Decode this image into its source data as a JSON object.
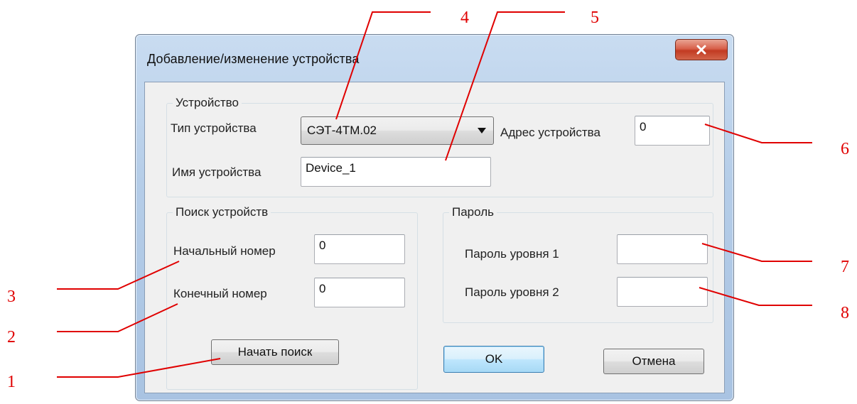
{
  "window": {
    "title": "Добавление/изменение устройства",
    "close_label": "✕"
  },
  "device_group": {
    "legend": "Устройство",
    "type_label": "Тип устройства",
    "type_value": "СЭТ-4ТМ.02",
    "address_label": "Адрес устройства",
    "address_value": "0",
    "name_label": "Имя устройства",
    "name_value": "Device_1"
  },
  "search_group": {
    "legend": "Поиск устройств",
    "start_label": "Начальный номер",
    "start_value": "0",
    "end_label": "Конечный номер",
    "end_value": "0",
    "search_button": "Начать поиск"
  },
  "password_group": {
    "legend": "Пароль",
    "level1_label": "Пароль уровня 1",
    "level1_value": "",
    "level2_label": "Пароль уровня 2",
    "level2_value": ""
  },
  "buttons": {
    "ok": "OK",
    "cancel": "Отмена"
  },
  "callouts": {
    "n1": "1",
    "n2": "2",
    "n3": "3",
    "n4": "4",
    "n5": "5",
    "n6": "6",
    "n7": "7",
    "n8": "8",
    "color": "#e00000"
  },
  "colors": {
    "titlebar": "#b5cde8",
    "client": "#f0f0f0",
    "close_button": "#c23b22",
    "default_button_border": "#3c7fb1"
  }
}
